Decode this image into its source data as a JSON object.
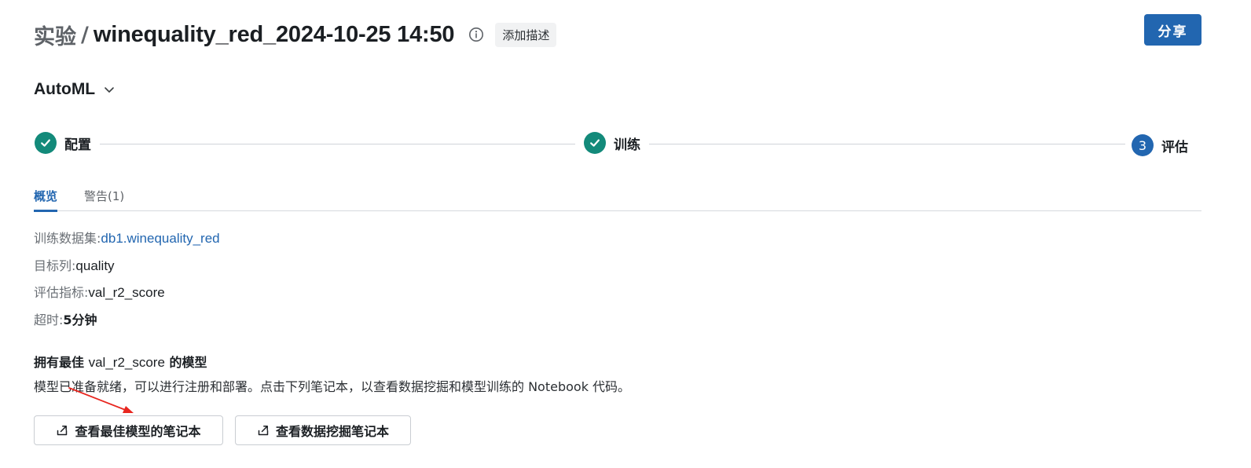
{
  "header": {
    "breadcrumb_root": "实验",
    "separator": "/",
    "title": "winequality_red_2024-10-25 14:50",
    "info_icon": "info-icon",
    "add_description_label": "添加描述",
    "share_label": "分享"
  },
  "selector": {
    "label": "AutoML",
    "icon": "chevron-down-icon"
  },
  "stepper": {
    "steps": [
      {
        "label": "配置",
        "state": "done"
      },
      {
        "label": "训练",
        "state": "done"
      },
      {
        "label": "评估",
        "state": "current",
        "number": "3"
      }
    ]
  },
  "tabs": [
    {
      "label": "概览",
      "active": true
    },
    {
      "label": "警告(1)",
      "active": false
    }
  ],
  "info": {
    "dataset_label": "训练数据集:",
    "dataset_value": "db1.winequality_red",
    "target_label": "目标列:",
    "target_value": "quality",
    "metric_label": "评估指标:",
    "metric_value": "val_r2_score",
    "timeout_label": "超时:",
    "timeout_value": "5分钟"
  },
  "best_model": {
    "title_prefix": "拥有最佳",
    "title_metric": "val_r2_score",
    "title_suffix": "的模型",
    "description": "模型已准备就绪，可以进行注册和部署。点击下列笔记本，以查看数据挖掘和模型训练的 Notebook 代码。",
    "buttons": [
      {
        "label": "查看最佳模型的笔记本",
        "icon": "external-link-icon"
      },
      {
        "label": "查看数据挖掘笔记本",
        "icon": "external-link-icon"
      }
    ]
  },
  "colors": {
    "accent": "#2266b0",
    "success": "#138a7a",
    "annotation_arrow": "#e8261f"
  }
}
